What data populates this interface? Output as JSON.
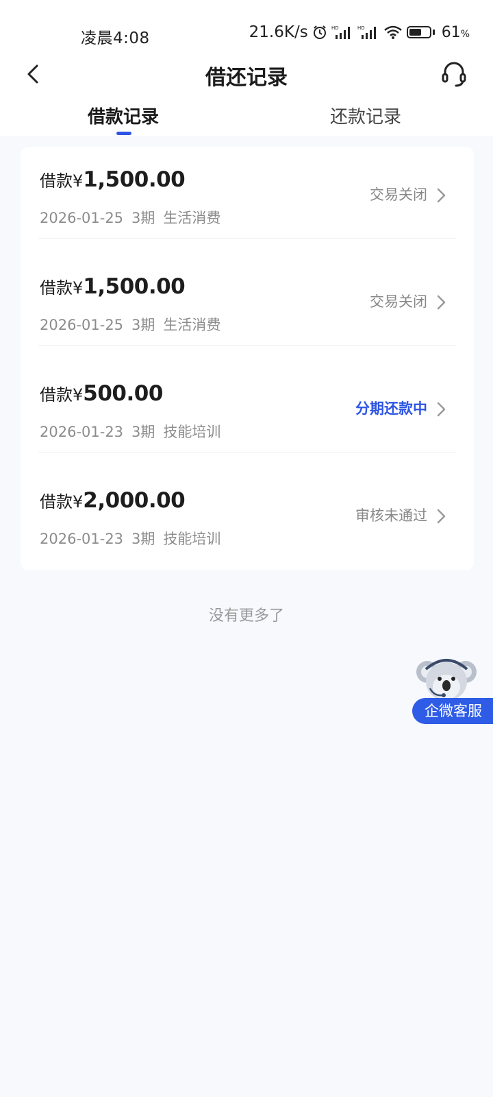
{
  "status_bar": {
    "time": "凌晨4:08",
    "net_speed": "21.6K/s",
    "battery_pct": "61",
    "battery_unit": "%",
    "battery_level": 0.61
  },
  "header": {
    "title": "借还记录",
    "back_icon": "chevron-left-icon",
    "service_icon": "headset-icon"
  },
  "tabs": [
    {
      "label": "借款记录",
      "active": true
    },
    {
      "label": "还款记录",
      "active": false
    }
  ],
  "records": [
    {
      "prefix": "借款¥",
      "amount": "1,500.00",
      "date": "2026-01-25",
      "periods": "3期",
      "purpose": "生活消费",
      "status": "交易关闭"
    },
    {
      "prefix": "借款¥",
      "amount": "1,500.00",
      "date": "2026-01-25",
      "periods": "3期",
      "purpose": "生活消费",
      "status": "交易关闭"
    },
    {
      "prefix": "借款¥",
      "amount": "500.00",
      "date": "2026-01-23",
      "periods": "3期",
      "purpose": "技能培训",
      "status": "分期还款中"
    },
    {
      "prefix": "借款¥",
      "amount": "2,000.00",
      "date": "2026-01-23",
      "periods": "3期",
      "purpose": "技能培训",
      "status": "审核未通过"
    }
  ],
  "footer_text": "没有更多了",
  "floating_service": {
    "label": "企微客服",
    "icon": "koala-headset-icon"
  },
  "colors": {
    "accent": "#2d55e4",
    "background": "#f7f9fd",
    "muted": "#8c8c8c"
  }
}
